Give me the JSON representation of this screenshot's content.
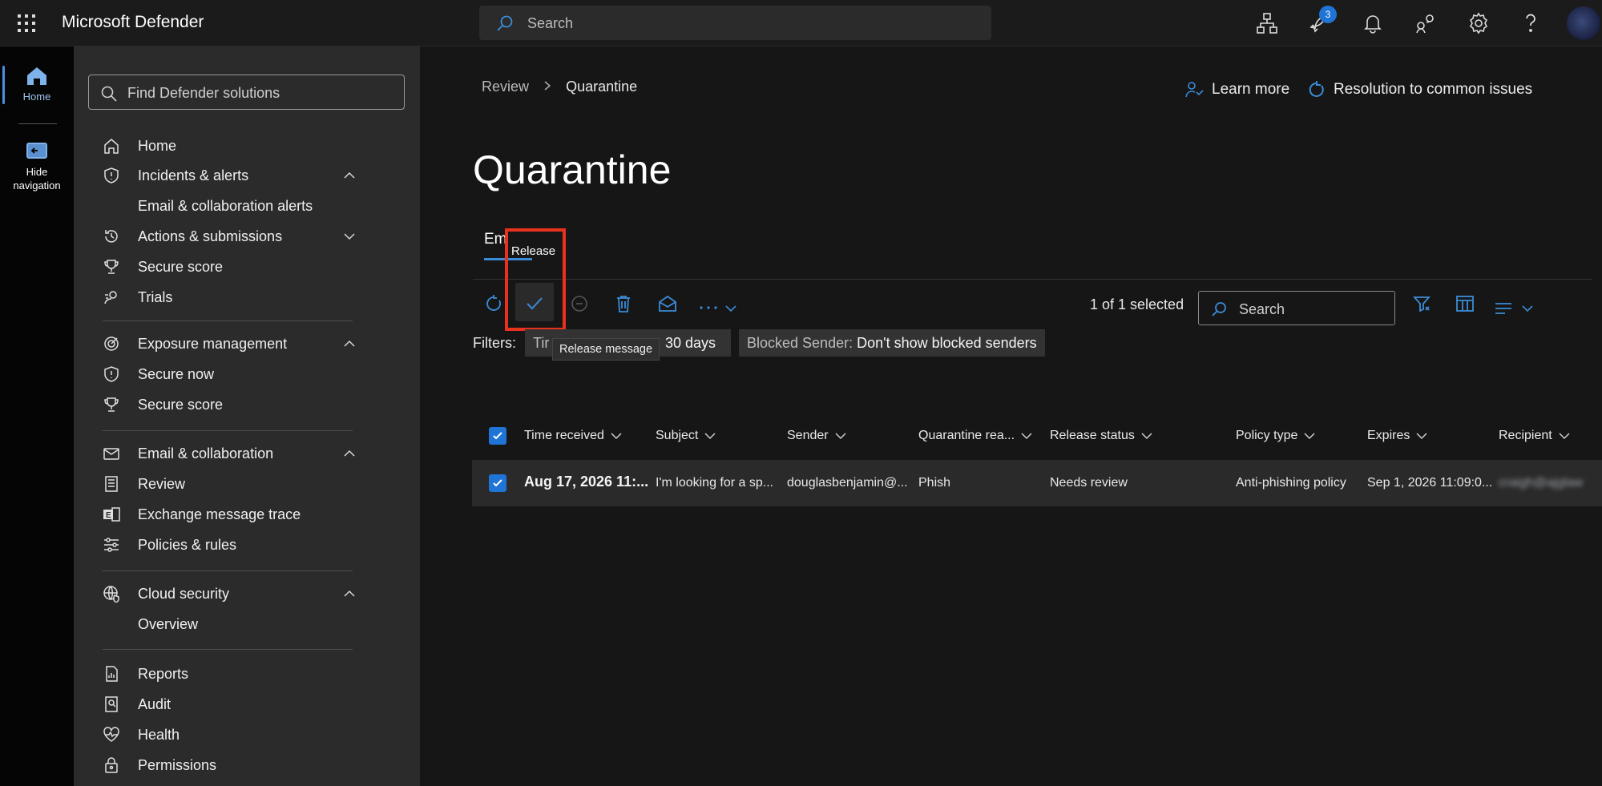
{
  "topbar": {
    "app_title": "Microsoft Defender",
    "search_placeholder": "Search",
    "notification_count": "3",
    "icons": [
      "waffle-icon",
      "org-chart-icon",
      "rocket-icon",
      "bell-icon",
      "community-icon",
      "gear-icon",
      "help-icon"
    ]
  },
  "rail": {
    "home_label": "Home",
    "hide_nav_label_1": "Hide",
    "hide_nav_label_2": "navigation"
  },
  "nav": {
    "search_placeholder": "Find Defender solutions",
    "items": [
      {
        "label": "Home",
        "icon": "home-icon"
      },
      {
        "label": "Incidents & alerts",
        "icon": "shield-alert-icon"
      },
      {
        "label": "Email & collaboration alerts"
      },
      {
        "label": "Actions & submissions",
        "icon": "history-icon"
      },
      {
        "label": "Secure score",
        "icon": "trophy-icon"
      },
      {
        "label": "Trials",
        "icon": "trials-icon"
      },
      {
        "label": "Exposure management",
        "icon": "target-icon"
      },
      {
        "label": "Secure now",
        "icon": "shield-alert-icon"
      },
      {
        "label": "Secure score",
        "icon": "trophy-icon"
      },
      {
        "label": "Email & collaboration",
        "icon": "mail-icon"
      },
      {
        "label": "Review",
        "icon": "document-list-icon"
      },
      {
        "label": "Exchange message trace",
        "icon": "exchange-icon"
      },
      {
        "label": "Policies & rules",
        "icon": "sliders-icon"
      },
      {
        "label": "Cloud security",
        "icon": "globe-shield-icon"
      },
      {
        "label": "Overview"
      },
      {
        "label": "Reports",
        "icon": "report-icon"
      },
      {
        "label": "Audit",
        "icon": "audit-icon"
      },
      {
        "label": "Health",
        "icon": "heart-pulse-icon"
      },
      {
        "label": "Permissions",
        "icon": "lock-icon"
      }
    ]
  },
  "main": {
    "breadcrumb": [
      "Review",
      "Quarantine"
    ],
    "learn_more": "Learn more",
    "resolution": "Resolution to common issues",
    "title": "Quarantine",
    "tab_label": "Em",
    "tooltip_top": "Release",
    "tooltip_release_message": "Release message",
    "selected_count": "1 of 1 selected",
    "search_placeholder": "Search",
    "filters_label": "Filters:",
    "filter_time_key": "Tir",
    "filter_time_value": "30 days",
    "filter_sender_key": "Blocked Sender:",
    "filter_sender_value": "Don't show blocked senders",
    "columns": [
      "Time received",
      "Subject",
      "Sender",
      "Quarantine rea...",
      "Release status",
      "Policy type",
      "Expires",
      "Recipient"
    ],
    "rows": [
      {
        "time_received": "Aug 17, 2026 11:...",
        "subject": "I'm looking for a sp...",
        "sender": "douglasbenjamin@...",
        "quarantine_reason": "Phish",
        "release_status": "Needs review",
        "policy_type": "Anti-phishing policy",
        "expires": "Sep 1, 2026 11:09:0...",
        "recipient": "craigh@ajglaw"
      }
    ]
  },
  "colors": {
    "accent": "#1f74d6",
    "highlight": "#e8321e",
    "link_icon": "#3b8cd8"
  }
}
